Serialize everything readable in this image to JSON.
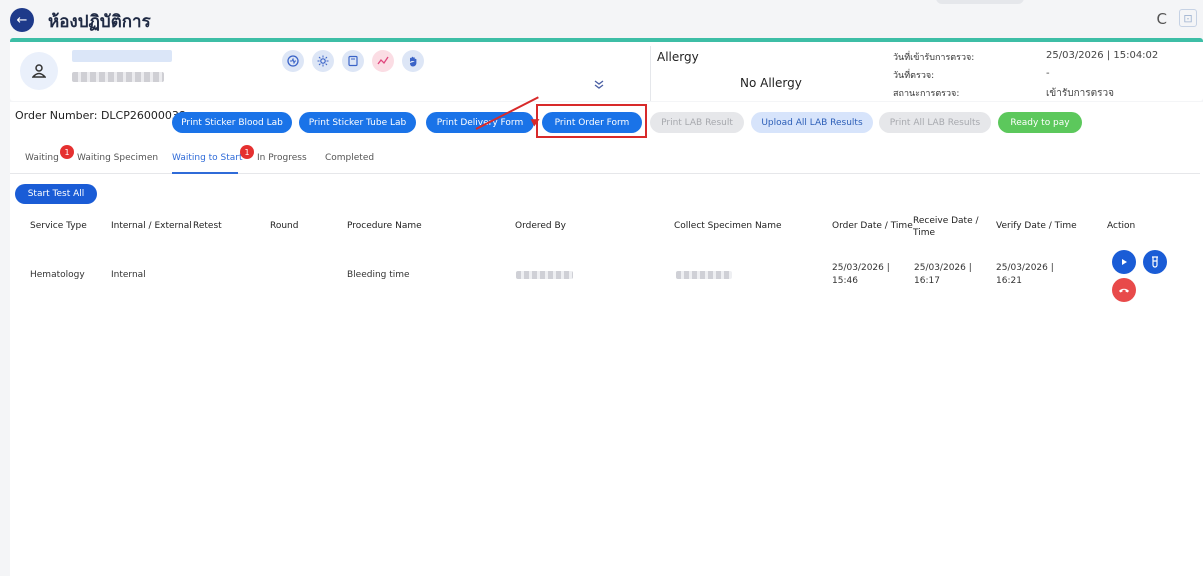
{
  "header": {
    "title": "ห้องปฏิบัติการ",
    "back_icon": "←",
    "refresh_icon": "C",
    "expand_icon": "⊡"
  },
  "patient": {
    "allergy_label": "Allergy",
    "allergy_value": "No Allergy",
    "meta": [
      {
        "label": "วันที่เข้ารับการตรวจ:",
        "value": "25/03/2026 | 15:04:02"
      },
      {
        "label": "วันที่ตรวจ:",
        "value": "-"
      },
      {
        "label": "สถานะการตรวจ:",
        "value": "เข้ารับการตรวจ"
      }
    ]
  },
  "order": {
    "number_label": "Order Number: DLCP26000038",
    "buttons": [
      {
        "label": "Print Sticker Blood Lab",
        "state": "primary"
      },
      {
        "label": "Print Sticker Tube Lab",
        "state": "primary"
      },
      {
        "label": "Print Delivery Form",
        "state": "primary"
      },
      {
        "label": "Print Order Form",
        "state": "primary"
      },
      {
        "label": "Print LAB Result",
        "state": "disabled"
      },
      {
        "label": "Upload All LAB Results",
        "state": "light"
      },
      {
        "label": "Print All LAB Results",
        "state": "disabled"
      },
      {
        "label": "Ready to pay",
        "state": "success"
      }
    ]
  },
  "tabs": [
    {
      "label": "Waiting",
      "badge": "1"
    },
    {
      "label": "Waiting Specimen"
    },
    {
      "label": "Waiting to Start",
      "badge": "1",
      "active": true
    },
    {
      "label": "In Progress"
    },
    {
      "label": "Completed"
    }
  ],
  "start_all_label": "Start Test All",
  "table": {
    "headers": [
      "Service Type",
      "Internal / External",
      "Retest",
      "Round",
      "Procedure Name",
      "Ordered By",
      "Collect Specimen Name",
      "Order Date / Time",
      "Receive Date / Time",
      "Verify Date / Time",
      "Action"
    ],
    "rows": [
      {
        "service_type": "Hematology",
        "internal_external": "Internal",
        "procedure": "Bleeding time",
        "order_dt": [
          "25/03/2026 |",
          "15:46"
        ],
        "receive_dt": [
          "25/03/2026 |",
          "16:17"
        ],
        "verify_dt": [
          "25/03/2026 |",
          "16:21"
        ]
      }
    ]
  },
  "colors": {
    "accent": "#1a73e8",
    "teal": "#3dbea6",
    "danger": "#e53030",
    "success": "#5cc85c",
    "highlight": "#d82a2a"
  }
}
